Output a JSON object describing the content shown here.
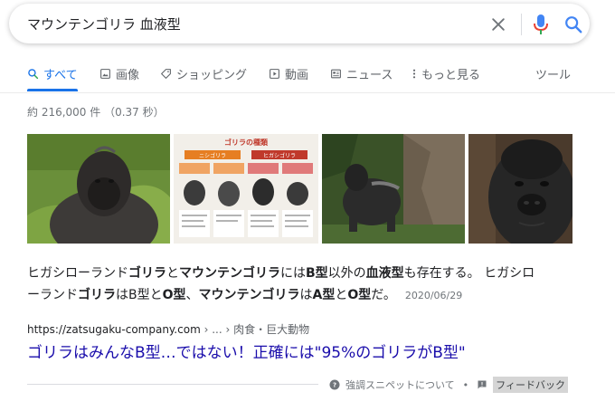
{
  "search": {
    "query": "マウンテンゴリラ 血液型"
  },
  "tabs": [
    {
      "label": "すべて",
      "icon": "search-icon",
      "active": true
    },
    {
      "label": "画像",
      "icon": "image-icon"
    },
    {
      "label": "ショッピング",
      "icon": "tag-icon"
    },
    {
      "label": "動画",
      "icon": "video-icon"
    },
    {
      "label": "ニュース",
      "icon": "news-icon"
    },
    {
      "label": "もっと見る",
      "icon": "more-icon"
    }
  ],
  "tools_label": "ツール",
  "result_stats": "約 216,000 件 （0.37 秒）",
  "chart_card": {
    "title": "ゴリラの種類",
    "left_group": "ニシゴリラ",
    "right_group": "ヒガシゴリラ"
  },
  "snippet": {
    "line1_parts": [
      "ヒガシローランド",
      "ゴリラ",
      "と",
      "マウンテンゴリラ",
      "には",
      "B型",
      "以外の",
      "血液型",
      "も存在する。 ヒガシロ"
    ],
    "line2_parts": [
      "ーランド",
      "ゴリラ",
      "は",
      "B型",
      "と",
      "O型",
      "、",
      "マウンテンゴリラ",
      "は",
      "A型",
      "と",
      "O型",
      "だ。"
    ],
    "date": "2020/06/29"
  },
  "result": {
    "url": "https://zatsugaku-company.com",
    "breadcrumb": " › ... › 肉食・巨大動物",
    "title": "ゴリラはみんなB型…ではない！正確には\"95%のゴリラがB型\""
  },
  "footer": {
    "about_label": "強調スニペットについて",
    "separator": "•",
    "feedback_label": "フィードバック"
  },
  "colors": {
    "accent": "#1a73e8",
    "link": "#1a0dab",
    "mic_blue": "#4285f4",
    "mic_red": "#ea4335"
  }
}
